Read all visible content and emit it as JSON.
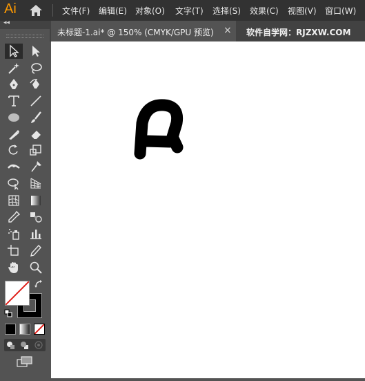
{
  "app": {
    "logo": "Ai"
  },
  "menu": [
    {
      "label": "文件(F)"
    },
    {
      "label": "编辑(E)"
    },
    {
      "label": "对象(O)"
    },
    {
      "label": "文字(T)"
    },
    {
      "label": "选择(S)"
    },
    {
      "label": "效果(C)"
    },
    {
      "label": "视图(V)"
    },
    {
      "label": "窗口(W)"
    }
  ],
  "panel": {
    "collapse_glyph": "◂◂"
  },
  "tabs": {
    "active": {
      "label": "未标题-1.ai* @ 150% (CMYK/GPU 预览)",
      "close": "×"
    },
    "other": {
      "label": "软件自学网：RJZXW.COM"
    }
  },
  "tools": [
    {
      "icon": "selection-tool-icon"
    },
    {
      "icon": "direct-selection-tool-icon"
    },
    {
      "icon": "magic-wand-tool-icon"
    },
    {
      "icon": "lasso-tool-icon"
    },
    {
      "icon": "pen-tool-icon"
    },
    {
      "icon": "curvature-tool-icon"
    },
    {
      "icon": "type-tool-icon"
    },
    {
      "icon": "line-segment-tool-icon"
    },
    {
      "icon": "ellipse-tool-icon"
    },
    {
      "icon": "paintbrush-tool-icon"
    },
    {
      "icon": "shaper-tool-icon"
    },
    {
      "icon": "eraser-tool-icon"
    },
    {
      "icon": "rotate-tool-icon"
    },
    {
      "icon": "scale-tool-icon"
    },
    {
      "icon": "width-tool-icon"
    },
    {
      "icon": "puppet-warp-tool-icon"
    },
    {
      "icon": "shape-builder-tool-icon"
    },
    {
      "icon": "perspective-grid-tool-icon"
    },
    {
      "icon": "mesh-tool-icon"
    },
    {
      "icon": "gradient-tool-icon"
    },
    {
      "icon": "eyedropper-tool-icon"
    },
    {
      "icon": "blend-tool-icon"
    },
    {
      "icon": "symbol-sprayer-tool-icon"
    },
    {
      "icon": "column-graph-tool-icon"
    },
    {
      "icon": "artboard-tool-icon"
    },
    {
      "icon": "slice-tool-icon"
    },
    {
      "icon": "hand-tool-icon"
    },
    {
      "icon": "zoom-tool-icon"
    }
  ],
  "colors": {
    "accent": "#ff9a00",
    "fill": "#ffffff",
    "stroke": "#000000",
    "none_slash": "#e0201b"
  },
  "bottom": {
    "color_modes": [
      "color-icon",
      "gradient-icon",
      "none-icon"
    ],
    "draw_modes": [
      "draw-normal-icon",
      "draw-behind-icon",
      "draw-inside-icon"
    ],
    "screen_mode": "change-screen-mode-icon"
  }
}
